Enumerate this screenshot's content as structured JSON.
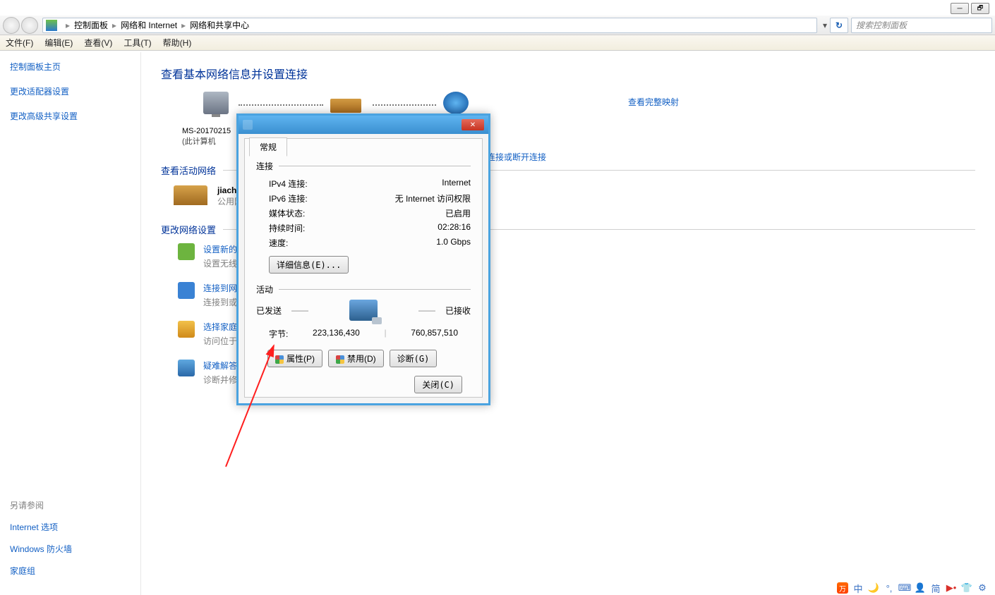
{
  "window": {
    "search_placeholder": "搜索控制面板"
  },
  "breadcrumb": {
    "a": "控制面板",
    "b": "网络和 Internet",
    "c": "网络和共享中心"
  },
  "menu": {
    "file": "文件(F)",
    "edit": "编辑(E)",
    "view": "查看(V)",
    "tools": "工具(T)",
    "help": "帮助(H)"
  },
  "sidebar": {
    "home": "控制面板主页",
    "adapter": "更改适配器设置",
    "sharing": "更改高级共享设置",
    "see_also": "另请参阅",
    "inet_options": "Internet 选项",
    "firewall": "Windows 防火墙",
    "homegroup": "家庭组"
  },
  "content": {
    "title": "查看基本网络信息并设置连接",
    "maplink": "查看完整映射",
    "host": "MS-20170215",
    "host_sub": "(此计算机",
    "active_label": "查看活动网络",
    "connect_disconnect": "连接或断开连接",
    "net_name": "jiach",
    "net_type": "公用网",
    "change_label": "更改网络设置",
    "tasks": [
      {
        "title": "设置新的连",
        "desc": "设置无线、"
      },
      {
        "title": "连接到网络",
        "desc": "连接到或重"
      },
      {
        "title": "选择家庭组",
        "desc": "访问位于其"
      },
      {
        "title": "疑难解答",
        "desc": "诊断并修复"
      }
    ]
  },
  "dialog": {
    "tab": "常规",
    "section_conn": "连接",
    "rows": {
      "ipv4_k": "IPv4 连接:",
      "ipv4_v": "Internet",
      "ipv6_k": "IPv6 连接:",
      "ipv6_v": "无 Internet 访问权限",
      "media_k": "媒体状态:",
      "media_v": "已启用",
      "duration_k": "持续时间:",
      "duration_v": "02:28:16",
      "speed_k": "速度:",
      "speed_v": "1.0 Gbps"
    },
    "details_btn": "详细信息(E)...",
    "section_activity": "活动",
    "sent": "已发送",
    "recv": "已接收",
    "bytes_label": "字节:",
    "bytes_sent": "223,136,430",
    "bytes_recv": "760,857,510",
    "btn_props": "属性(P)",
    "btn_disable": "禁用(D)",
    "btn_diag": "诊断(G)",
    "btn_close": "关闭(C)"
  },
  "tray": {
    "cn": "中",
    "jian": "简"
  }
}
